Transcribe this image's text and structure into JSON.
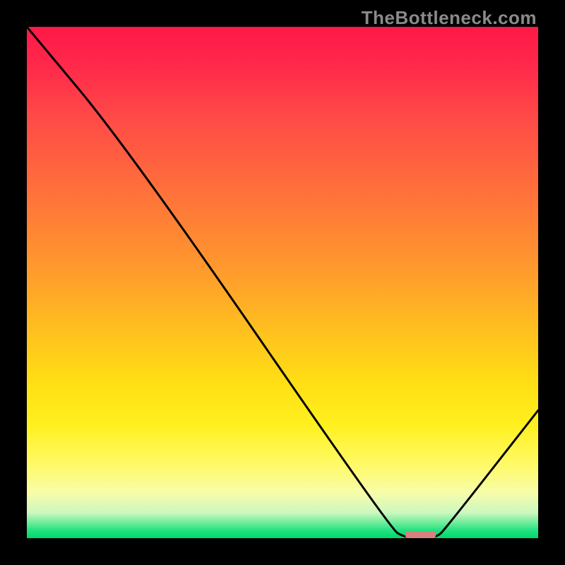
{
  "watermark": "TheBottleneck.com",
  "chart_data": {
    "type": "line",
    "title": "",
    "xlabel": "",
    "ylabel": "",
    "xlim": [
      0,
      100
    ],
    "ylim": [
      0,
      100
    ],
    "x": [
      0,
      20,
      71,
      74,
      80,
      82,
      100
    ],
    "values": [
      100,
      76,
      2,
      0,
      0,
      2,
      25
    ],
    "minimum_band": {
      "x_start": 74,
      "x_end": 80,
      "color": "#d88080"
    }
  },
  "colors": {
    "curve": "#000000",
    "background_frame": "#000000",
    "min_marker": "#d88080"
  }
}
